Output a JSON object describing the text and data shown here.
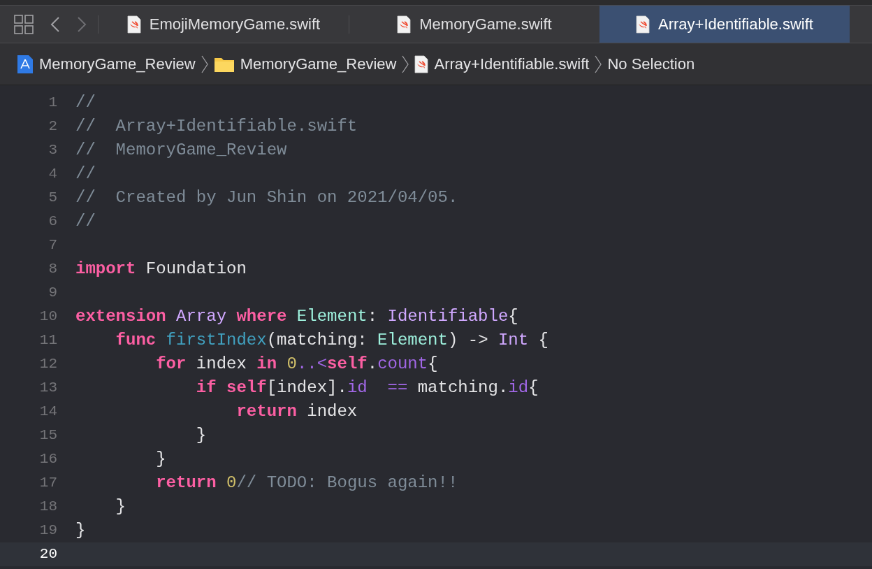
{
  "tabs": [
    {
      "title": "EmojiMemoryGame.swift",
      "selected": false
    },
    {
      "title": "MemoryGame.swift",
      "selected": false
    },
    {
      "title": "Array+Identifiable.swift",
      "selected": true
    }
  ],
  "breadcrumbs": [
    {
      "kind": "project",
      "label": "MemoryGame_Review"
    },
    {
      "kind": "folder",
      "label": "MemoryGame_Review"
    },
    {
      "kind": "file",
      "label": "Array+Identifiable.swift"
    },
    {
      "kind": "plain",
      "label": "No Selection"
    }
  ],
  "lines": [
    {
      "number": "1",
      "current": false,
      "tokens": [
        {
          "kind": "comment",
          "text": "//"
        }
      ]
    },
    {
      "number": "2",
      "current": false,
      "tokens": [
        {
          "kind": "comment",
          "text": "//  Array+Identifiable.swift"
        }
      ]
    },
    {
      "number": "3",
      "current": false,
      "tokens": [
        {
          "kind": "comment",
          "text": "//  MemoryGame_Review"
        }
      ]
    },
    {
      "number": "4",
      "current": false,
      "tokens": [
        {
          "kind": "comment",
          "text": "//"
        }
      ]
    },
    {
      "number": "5",
      "current": false,
      "tokens": [
        {
          "kind": "comment",
          "text": "//  Created by Jun Shin on 2021/04/05."
        }
      ]
    },
    {
      "number": "6",
      "current": false,
      "tokens": [
        {
          "kind": "comment",
          "text": "//"
        }
      ]
    },
    {
      "number": "7",
      "current": false
    },
    {
      "number": "8",
      "current": false,
      "tokens": [
        {
          "kind": "keyword",
          "text": "import"
        },
        {
          "kind": "plain",
          "text": " Foundation"
        }
      ]
    },
    {
      "number": "9",
      "current": false
    },
    {
      "number": "10",
      "current": false,
      "tokens": [
        {
          "kind": "keyword",
          "text": "extension"
        },
        {
          "kind": "type",
          "text": " Array"
        },
        {
          "kind": "keyword",
          "text": " where"
        },
        {
          "kind": "projecttype",
          "text": " Element"
        },
        {
          "kind": "plain",
          "text": ": "
        },
        {
          "kind": "type",
          "text": "Identifiable"
        },
        {
          "kind": "plain",
          "text": "{"
        }
      ]
    },
    {
      "number": "11",
      "current": false,
      "tokens": [
        {
          "kind": "keyword",
          "text": "    func"
        },
        {
          "kind": "declaration",
          "text": " firstIndex"
        },
        {
          "kind": "plain",
          "text": "(matching: "
        },
        {
          "kind": "projecttype",
          "text": "Element"
        },
        {
          "kind": "plain",
          "text": ") -> "
        },
        {
          "kind": "type",
          "text": "Int"
        },
        {
          "kind": "plain",
          "text": " {"
        }
      ]
    },
    {
      "number": "12",
      "current": false,
      "tokens": [
        {
          "kind": "keyword",
          "text": "        for"
        },
        {
          "kind": "plain",
          "text": " index "
        },
        {
          "kind": "keyword",
          "text": "in"
        },
        {
          "kind": "number",
          "text": " 0"
        },
        {
          "kind": "member",
          "text": "..<"
        },
        {
          "kind": "keyword",
          "text": "self"
        },
        {
          "kind": "plain",
          "text": "."
        },
        {
          "kind": "member",
          "text": "count"
        },
        {
          "kind": "plain",
          "text": "{"
        }
      ]
    },
    {
      "number": "13",
      "current": false,
      "tokens": [
        {
          "kind": "keyword",
          "text": "            if"
        },
        {
          "kind": "keyword",
          "text": " self"
        },
        {
          "kind": "plain",
          "text": "[index]."
        },
        {
          "kind": "member",
          "text": "id"
        },
        {
          "kind": "member",
          "text": "  =="
        },
        {
          "kind": "plain",
          "text": " matching."
        },
        {
          "kind": "member",
          "text": "id"
        },
        {
          "kind": "plain",
          "text": "{"
        }
      ]
    },
    {
      "number": "14",
      "current": false,
      "tokens": [
        {
          "kind": "keyword",
          "text": "                return"
        },
        {
          "kind": "plain",
          "text": " index"
        }
      ]
    },
    {
      "number": "15",
      "current": false,
      "tokens": [
        {
          "kind": "plain",
          "text": "            }"
        }
      ]
    },
    {
      "number": "16",
      "current": false,
      "tokens": [
        {
          "kind": "plain",
          "text": "        }"
        }
      ]
    },
    {
      "number": "17",
      "current": false,
      "tokens": [
        {
          "kind": "keyword",
          "text": "        return"
        },
        {
          "kind": "number",
          "text": " 0"
        },
        {
          "kind": "comment",
          "text": "// TODO: Bogus again!!"
        }
      ]
    },
    {
      "number": "18",
      "current": false,
      "tokens": [
        {
          "kind": "plain",
          "text": "    }"
        }
      ]
    },
    {
      "number": "19",
      "current": false,
      "tokens": [
        {
          "kind": "plain",
          "text": "}"
        }
      ]
    },
    {
      "number": "20",
      "current": true
    }
  ]
}
